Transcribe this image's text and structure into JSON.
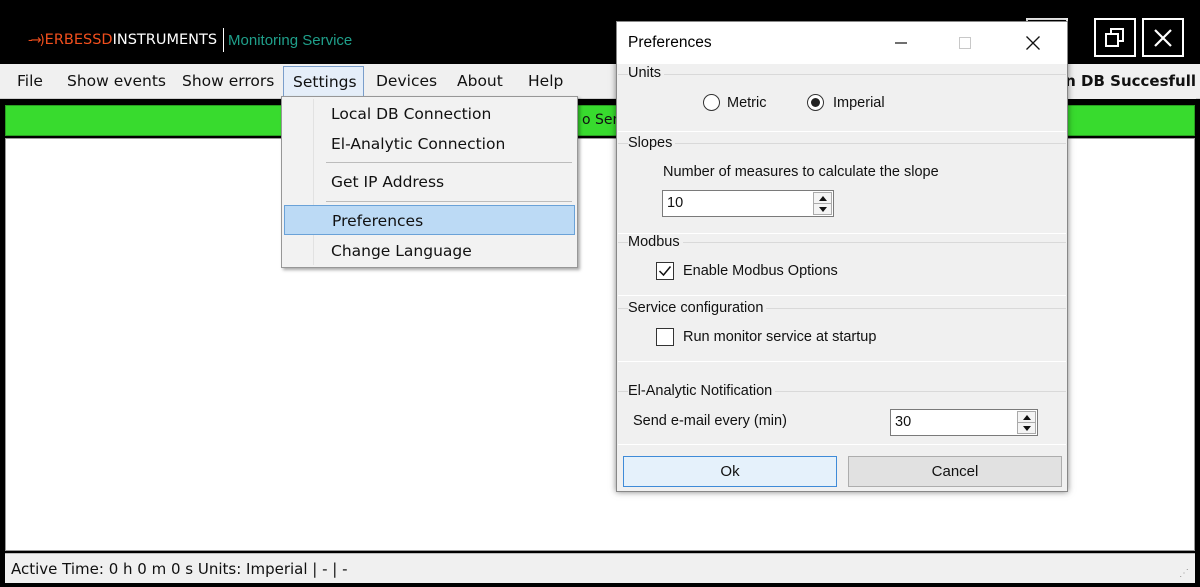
{
  "app": {
    "brand_mark": "-→)",
    "company_accent": "ERBESSD",
    "company_rest": " INSTRUMENTS",
    "service": "Monitoring Service"
  },
  "menu": {
    "items": [
      "File",
      "Show events",
      "Show errors",
      "Settings",
      "Devices",
      "About",
      "Help"
    ],
    "notice": "on DB Succesfull"
  },
  "status_strip": {
    "text": "o Sens"
  },
  "settings_menu": {
    "items": [
      "Local DB Connection",
      "El-Analytic Connection",
      "Get IP Address",
      "Preferences",
      "Change Language"
    ]
  },
  "preferences": {
    "title": "Preferences",
    "units": {
      "label": "Units",
      "metric": "Metric",
      "imperial": "Imperial",
      "selected": "Imperial"
    },
    "slopes": {
      "label": "Slopes",
      "measures_label": "Number of measures to calculate the slope",
      "measures_value": "10"
    },
    "modbus": {
      "label": "Modbus",
      "enable_label": "Enable Modbus Options",
      "enabled": true
    },
    "service": {
      "label": "Service configuration",
      "startup_label": "Run monitor service at startup",
      "startup": false
    },
    "notification": {
      "label": "El-Analytic Notification",
      "email_label": "Send e-mail every (min)",
      "email_value": "30"
    },
    "ok": "Ok",
    "cancel": "Cancel"
  },
  "status_bar": {
    "text": "Active Time:  0 h 0 m 0 s  Units: Imperial  |  -  |  -"
  },
  "colors": {
    "brand_accent": "#f24f1d",
    "service_teal": "#1f9f8a",
    "status_green": "#38db2e",
    "menu_highlight": "#bcdaf5"
  }
}
